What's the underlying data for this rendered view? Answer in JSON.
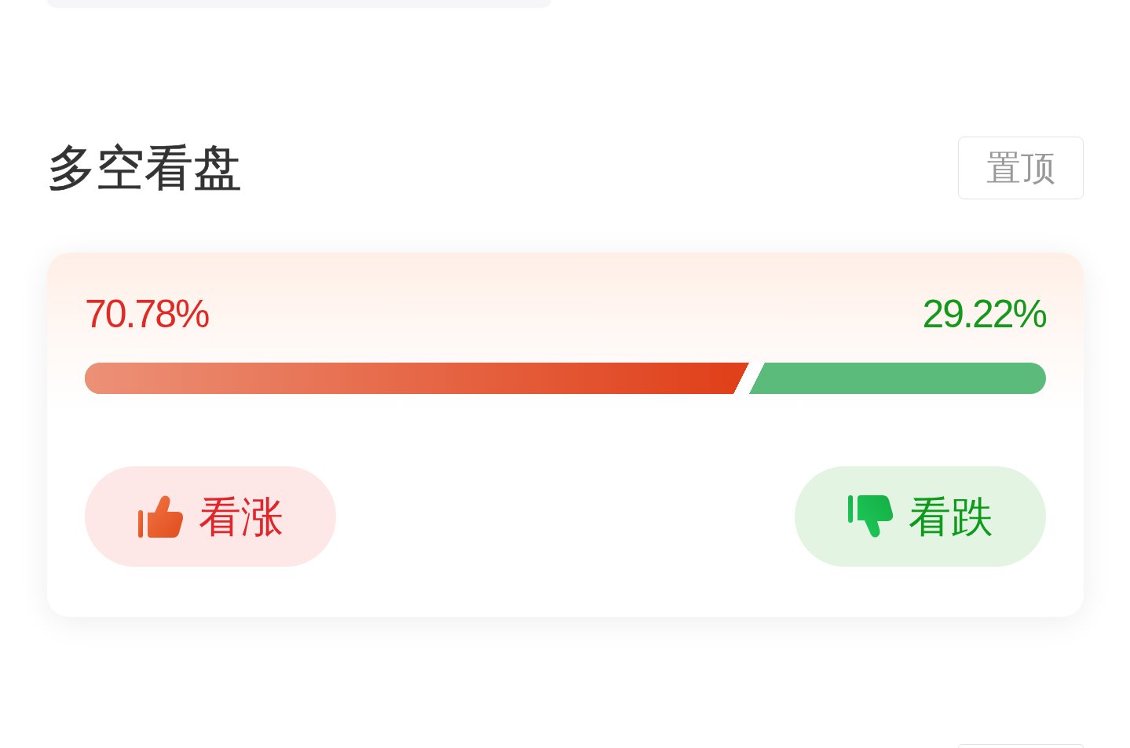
{
  "section": {
    "title": "多空看盘",
    "pin_button": "置顶"
  },
  "poll": {
    "sides": [
      {
        "kind": "bull",
        "percent": "70.78%",
        "level": 0.7078
      },
      {
        "kind": "bear",
        "percent": "29.22%"
      }
    ],
    "buttons": [
      {
        "kind": "bull",
        "label": "看涨"
      },
      {
        "kind": "bear",
        "label": "看跌"
      }
    ]
  }
}
